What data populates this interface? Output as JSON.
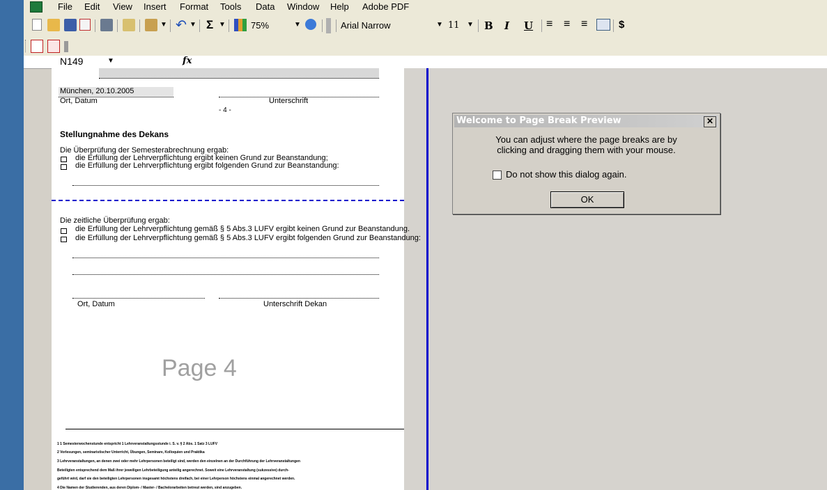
{
  "menubar": {
    "items": [
      "File",
      "Edit",
      "View",
      "Insert",
      "Format",
      "Tools",
      "Data",
      "Window",
      "Help",
      "Adobe PDF"
    ]
  },
  "toolbar": {
    "zoom": "75%",
    "font_name": "Arial Narrow",
    "font_size": "11",
    "bold": "B",
    "italic": "I",
    "underline": "U",
    "sigma": "Σ",
    "currency": "$"
  },
  "formula_bar": {
    "name_box": "N149",
    "fx": "fx"
  },
  "sheet": {
    "place_date_value": "München, 20.10.2005",
    "place_date_label": "Ort, Datum",
    "signature_label": "Unterschrift",
    "page_number": "- 4 -",
    "dean_heading": "Stellungnahme des Dekans",
    "semester_check": "Die Überprüfung der Semesterabrechnung ergab:",
    "option1": "die Erfüllung der Lehrverpflichtung ergibt keinen Grund zur Beanstandung;",
    "option2": "die Erfüllung der Lehrverpflichtung ergibt folgenden Grund zur Beanstandung:",
    "time_check": "Die  zeitliche Überprüfung ergab:",
    "option3": "die Erfüllung der Lehrverpflichtung gemäß § 5 Abs.3 LUFV ergibt keinen Grund zur Beanstandung.",
    "option4": "die Erfüllung der Lehrverpflichtung gemäß § 5 Abs.3 LUFV ergibt folgenden Grund zur Beanstandung:",
    "place_date_label2": "Ort, Datum",
    "signature_dean": "Unterschrift Dekan",
    "watermark": "Page 4",
    "footnotes": [
      "1  1 Semesterwochenstunde entspricht 1 Lehrveranstaltungsstunde i. S. v. § 2 Abs. 1 Satz 3 LUFV",
      "2  Vorlesungen, seminaristischer Unterricht, Übungen, Seminare, Kolloquien und Praktika",
      "3  Lehrveranstaltungen, an denen zwei oder mehr Lehrpersonen beteiligt sind, werden den einzelnen an der Durchführung der Lehrveranstaltungen",
      "   Beteiligten entsprechend dem Maß ihrer jeweiligen Lehrbeteiligung anteilig angerechnet. Soweit eine Lehrveranstaltung (sukzessive) durch-",
      "   geführt wird, darf sie den beteiligten Lehrpersonen insgesamt höchstens dreifach, bei einer Lehrperson höchstens einmal angerechnet werden.",
      "4  Die Namen der Studierenden, aus deren Diplom- / Master- / Bachelorarbeiten betreut werden, sind anzugeben."
    ]
  },
  "dialog": {
    "title": "Welcome to Page Break Preview",
    "message_line1": "You can adjust where the page breaks are by",
    "message_line2": "clicking and dragging them with your mouse.",
    "checkbox_label": "Do not show this dialog again.",
    "ok_label": "OK",
    "close_glyph": "✕"
  }
}
